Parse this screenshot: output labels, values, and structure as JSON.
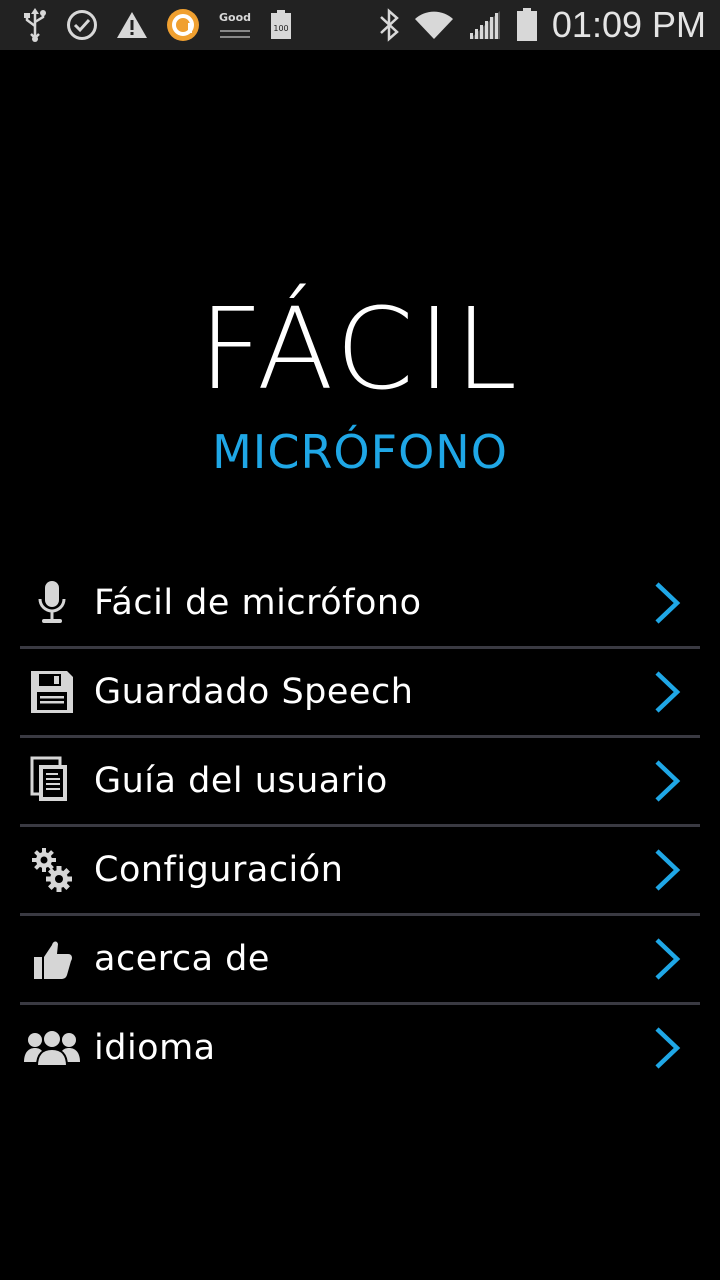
{
  "status_bar": {
    "time": "01:09 PM",
    "left_icons": [
      "usb-icon",
      "check-circle-icon",
      "warning-icon",
      "app-notification-icon",
      "good-widget-icon",
      "battery-100-icon"
    ],
    "good_text": "Good",
    "battery_text": "100",
    "right_icons": [
      "bluetooth-icon",
      "wifi-icon",
      "signal-icon",
      "battery-icon"
    ]
  },
  "header": {
    "title": "FÁCIL",
    "subtitle": "MICRÓFONO"
  },
  "colors": {
    "accent": "#1fa7e6",
    "background": "#000000",
    "divider": "#3a3a42"
  },
  "menu": {
    "items": [
      {
        "label": "Fácil de micrófono",
        "icon": "microphone-icon"
      },
      {
        "label": "Guardado Speech",
        "icon": "floppy-disk-icon"
      },
      {
        "label": "Guía del usuario",
        "icon": "documents-icon"
      },
      {
        "label": "Configuración",
        "icon": "gears-icon"
      },
      {
        "label": "acerca de",
        "icon": "thumbs-up-icon"
      },
      {
        "label": "idioma",
        "icon": "people-icon"
      }
    ]
  }
}
